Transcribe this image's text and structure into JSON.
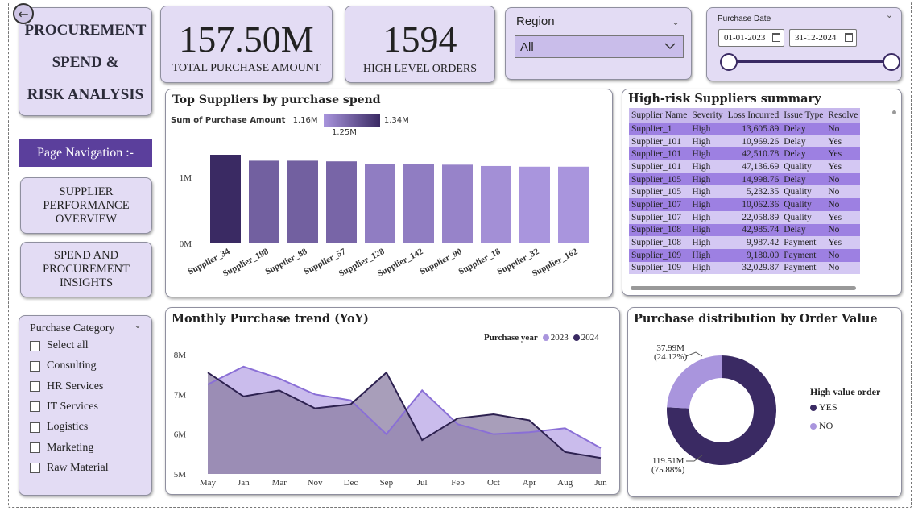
{
  "title": {
    "line1": "PROCUREMENT",
    "line2": "SPEND &",
    "line3": "RISK ANALYSIS"
  },
  "kpis": [
    {
      "value": "157.50M",
      "label": "TOTAL PURCHASE AMOUNT"
    },
    {
      "value": "1594",
      "label": "HIGH LEVEL ORDERS"
    }
  ],
  "region": {
    "label": "Region",
    "selected": "All"
  },
  "purchase_date": {
    "label": "Purchase Date",
    "start": "01-01-2023",
    "end": "31-12-2024"
  },
  "navigation": {
    "header": "Page Navigation :-",
    "buttons": [
      {
        "label": "SUPPLIER PERFORMANCE OVERVIEW"
      },
      {
        "label": "SPEND AND PROCUREMENT INSIGHTS"
      }
    ]
  },
  "purchase_category": {
    "label": "Purchase Category",
    "options": [
      "Select all",
      "Consulting",
      "HR Services",
      "IT Services",
      "Logistics",
      "Marketing",
      "Raw Material"
    ]
  },
  "top_suppliers": {
    "title": "Top Suppliers by purchase spend",
    "legend_label": "Sum of Purchase Amount",
    "legend_min": "1.16M",
    "legend_max": "1.34M",
    "legend_mid": "1.25M"
  },
  "high_risk": {
    "title": "High-risk Suppliers summary",
    "columns": [
      "Supplier Name",
      "Severity",
      "Loss Incurred",
      "Issue Type",
      "Resolve"
    ],
    "rows": [
      [
        "Supplier_1",
        "High",
        "13,605.89",
        "Delay",
        "No"
      ],
      [
        "Supplier_101",
        "High",
        "10,969.26",
        "Delay",
        "Yes"
      ],
      [
        "Supplier_101",
        "High",
        "42,510.78",
        "Delay",
        "Yes"
      ],
      [
        "Supplier_101",
        "High",
        "47,136.69",
        "Quality",
        "Yes"
      ],
      [
        "Supplier_105",
        "High",
        "14,998.76",
        "Delay",
        "No"
      ],
      [
        "Supplier_105",
        "High",
        "5,232.35",
        "Quality",
        "No"
      ],
      [
        "Supplier_107",
        "High",
        "10,062.36",
        "Quality",
        "No"
      ],
      [
        "Supplier_107",
        "High",
        "22,058.89",
        "Quality",
        "Yes"
      ],
      [
        "Supplier_108",
        "High",
        "42,985.74",
        "Delay",
        "No"
      ],
      [
        "Supplier_108",
        "High",
        "9,987.42",
        "Payment",
        "Yes"
      ],
      [
        "Supplier_109",
        "High",
        "9,180.00",
        "Payment",
        "No"
      ],
      [
        "Supplier_109",
        "High",
        "32,029.87",
        "Payment",
        "No"
      ]
    ]
  },
  "monthly_trend": {
    "title": "Monthly Purchase trend (YoY)",
    "legend_title": "Purchase year",
    "legend": [
      "2023",
      "2024"
    ]
  },
  "order_value": {
    "title": "Purchase distribution by Order Value",
    "legend_title": "High value order",
    "legend": [
      "YES",
      "NO"
    ],
    "label_no": "37.99M",
    "label_no_pct": "(24.12%)",
    "label_yes": "119.51M",
    "label_yes_pct": "(75.88%)"
  },
  "colors": {
    "lavender_card": "#e3dcf4",
    "dark_purple": "#3a2a63",
    "mid_purple": "#6a4fb0",
    "light_purple": "#a995dd",
    "table_row_dark": "#9d80e2",
    "table_row_light": "#d4c8f3"
  },
  "chart_data": [
    {
      "type": "bar",
      "title": "Top Suppliers by purchase spend",
      "categories": [
        "Supplier_34",
        "Supplier_198",
        "Supplier_88",
        "Supplier_57",
        "Supplier_128",
        "Supplier_142",
        "Supplier_90",
        "Supplier_18",
        "Supplier_32",
        "Supplier_162"
      ],
      "values": [
        1.34,
        1.25,
        1.25,
        1.24,
        1.2,
        1.2,
        1.19,
        1.17,
        1.16,
        1.16
      ],
      "unit": "M",
      "yticks": [
        "0M",
        "1M"
      ],
      "ylim": [
        0,
        1.34
      ]
    },
    {
      "type": "area",
      "title": "Monthly Purchase trend (YoY)",
      "categories": [
        "May",
        "Jan",
        "Mar",
        "Nov",
        "Dec",
        "Sep",
        "Jul",
        "Feb",
        "Oct",
        "Apr",
        "Aug",
        "Jun"
      ],
      "series": [
        {
          "name": "2023",
          "values": [
            7.25,
            7.7,
            7.4,
            7.0,
            6.85,
            6.0,
            7.1,
            6.25,
            6.0,
            6.05,
            6.15,
            5.65
          ]
        },
        {
          "name": "2024",
          "values": [
            7.55,
            6.95,
            7.1,
            6.65,
            6.75,
            7.55,
            5.85,
            6.4,
            6.5,
            6.35,
            5.55,
            5.4
          ]
        }
      ],
      "yticks": [
        "5M",
        "6M",
        "7M",
        "8M"
      ],
      "ylim": [
        5,
        8
      ]
    },
    {
      "type": "pie",
      "title": "Purchase distribution by Order Value",
      "labels": [
        "YES",
        "NO"
      ],
      "values": [
        119.51,
        37.99
      ],
      "percent": [
        75.88,
        24.12
      ]
    }
  ]
}
